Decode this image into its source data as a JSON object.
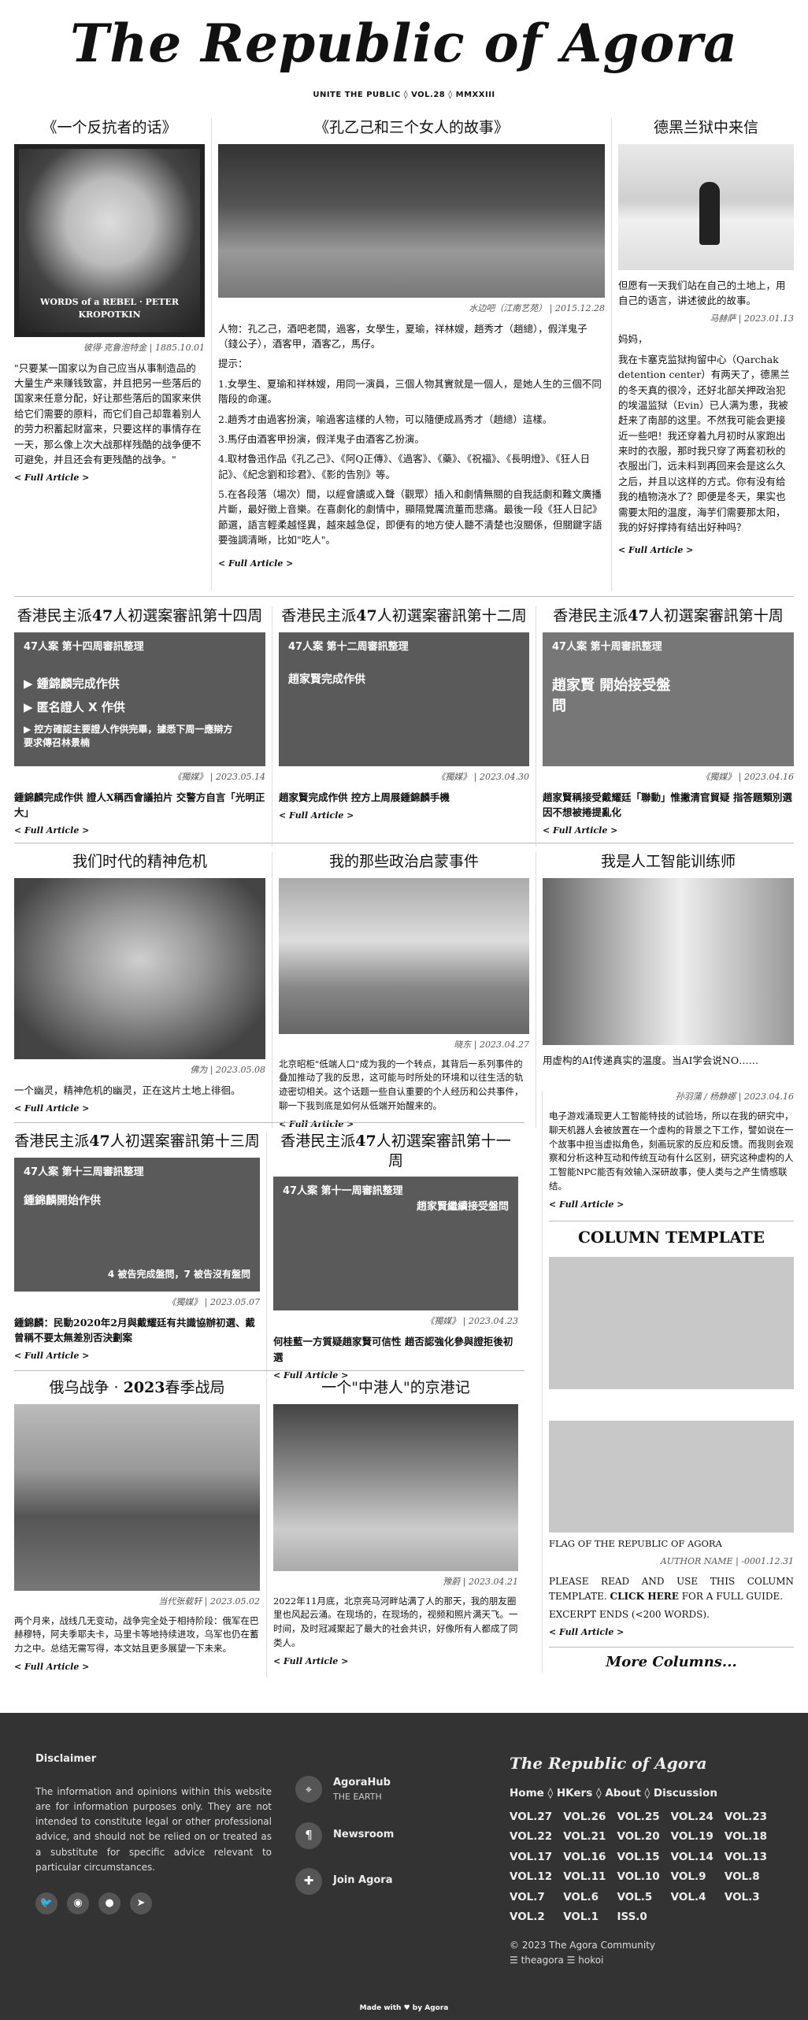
{
  "masthead": {
    "title": "The Republic of Agora",
    "subtitle": "UNITE THE PUBLIC ◊ VOL.28 ◊ MMXXIII"
  },
  "row1": {
    "a1": {
      "title": "《一个反抗者的话》",
      "img_text": "WORDS of a REBEL · PETER KROPOTKIN",
      "caption": "彼得·克鲁泡特金 | 1885.10.01",
      "body": "\"只要某一国家以为自己应当从事制造品的大量生产来赚钱致富，并且把另一些落后的国家来任意分配，好让那些落后的国家来供给它们需要的原料，而它们自己却靠着别人的劳力积蓄起财富来，只要这样的事情存在一天，那么像上次大战那样残酷的战争便不可避免，并且还会有更残酷的战争。\"",
      "more": "< Full Article >"
    },
    "a2": {
      "title": "《孔乙己和三个女人的故事》",
      "caption": "水边吧（江南艺苑） | 2015.12.28",
      "p1": "人物：孔乙己，酒吧老闆，過客，女學生，夏瑜，祥林嫂，趙秀才（趙總），假洋鬼子（錢公子），酒客甲，酒客乙，馬仔。",
      "p2": "提示：",
      "p3": "1.女學生、夏瑜和祥林嫂，用同一演員，三個人物其實就是一個人，是她人生的三個不同階段的命運。",
      "p4": "2.趙秀才由過客扮演，喻過客這樣的人物，可以隨便成爲秀才（趙總）這樣。",
      "p5": "3.馬仔由酒客甲扮演，假洋鬼子由酒客乙扮演。",
      "p6": "4.取材魯迅作品《孔乙己》、《阿Q正傳》、《過客》、《藥》、《祝福》、《長明燈》、《狂人日記》、《紀念劉和珍君》、《影的告別》等。",
      "p7": "5.在各段落（場次）間，以經會讀或入聲（觀眾）插入和劇情無關的自我話劇和難文廣播片斷，最好徵上音樂。在喜劇化的劇情中，顯隔覺厲流董而悲痛。最後一段《狂人日記》節選，語言輕柔越怪異，越來越急促，即便有的地方使人聽不清楚也沒關係，但關鍵字語要強調清晰，比如\"吃人\"。",
      "more": "< Full Article >"
    },
    "a3": {
      "title": "德黑兰狱中来信",
      "lead": "但愿有一天我们站在自己的土地上，用自己的语言，讲述彼此的故事。",
      "caption": "马赫萨 | 2023.01.13",
      "p1": "妈妈，",
      "p2": "我在卡塞克监狱拘留中心（Qarchak detention center）有两天了，德黑兰的冬天真的很冷，还好北部关押政治犯的埃温监狱（Evin）已人满为患，我被赶来了南部的这里。不然我可能会更接近一些吧！我还穿着九月初时从家跑出来时的衣服，那时我只穿了两套初秋的衣服出门，远未料到再回来会是这么久之后，并且以这样的方式。你有没有给我的植物浇水了？即便是冬天，果实也需要太阳的温度，海芋们需要那太阳，我的好好撑持有结出好种吗？",
      "more": "< Full Article >"
    }
  },
  "row2": {
    "a1": {
      "title_pre": "香港民主派",
      "title_num": "47",
      "title_post": "人初選案審訊第十四周",
      "slide_head": "47人案 第十四周審訊整理",
      "slide_b1": "▶ 鍾錦麟完成作供",
      "slide_b2": "▶ 匿名證人 X 作供",
      "slide_b3": "▶ 控方確認主要證人作供完畢，據悉下周一應辯方要求傳召林景楠",
      "caption": "《獨媒》 | 2023.05.14",
      "lead": "鍾錦麟完成作供 證人X稱西會議拍片 交警方自言「光明正大」",
      "more": "< Full Article >"
    },
    "a2": {
      "title_pre": "香港民主派",
      "title_num": "47",
      "title_post": "人初選案審訊第十二周",
      "slide_head": "47人案 第十二周審訊整理",
      "slide_sub": "趙家賢完成作供",
      "caption": "《獨媒》 | 2023.04.30",
      "lead": "趙家賢完成作供 控方上周展鍾錦麟手機",
      "more": "< Full Article >"
    },
    "a3": {
      "title_pre": "香港民主派",
      "title_num": "47",
      "title_post": "人初選案審訊第十周",
      "slide_head": "47人案 第十周審訊整理",
      "slide_sub": "趙家賢 開始接受盤問",
      "caption": "《獨媒》 | 2023.04.16",
      "lead": "趙家賢稱接受戴耀廷「聯動」惟撇清官貿疑 指答題類別選因不想被捲提亂化",
      "more": "< Full Article >"
    }
  },
  "row3": {
    "a1": {
      "title": "我们时代的精神危机",
      "caption": "佛为 | 2023.05.08",
      "lead": "一个幽灵，精神危机的幽灵，正在这片土地上徘徊。",
      "more": "< Full Article >"
    },
    "a2": {
      "title": "我的那些政治启蒙事件",
      "caption": "晓东 | 2023.04.27",
      "lead": "北京昭柜\"低端人口\"成为我的一个转点，其背后一系列事件的叠加推动了我的反思，这可能与时所处的环境和以往生活的轨迹密切相关。这个话题一些自认重要的个人经历和公共事件，聊一下我到底是如何从低端开始醒来的。",
      "more": "< Full Article >"
    },
    "a3": {
      "title": "我是人工智能训练师",
      "lead": "用虚构的AI传递真实的温度。当AI学会说NO……",
      "caption": "孙羽蒲 / 杨静娜 | 2023.04.16",
      "body": "电子游戏涌现更人工智能特技的试验场，所以在我的研究中，聊天机器人会被放置在一个虚构的背景之下工作，譬如说在一个故事中担当虚拟角色，刻画玩家的反应和反馈。而我则会观察和分析这种互动和传统互动有什么区别，研究这种虚构的人工智能NPC能否有效输入深研故事，使人类与之产生情感联结。",
      "more": "< Full Article >"
    }
  },
  "row4": {
    "a1": {
      "title_pre": "香港民主派",
      "title_num": "47",
      "title_post": "人初選案審訊第十三周",
      "slide_head": "47人案 第十三周審訊整理",
      "slide_sub": "鍾錦麟開始作供",
      "slide_foot": "4 被告完成盤問，7 被告沒有盤問",
      "caption": "《獨媒》 | 2023.05.07",
      "lead": "鍾錦麟：民動2020年2月與戴耀廷有共識協辦初選、戴曾稱不要太無差別否決劃案",
      "more": "< Full Article >"
    },
    "a2": {
      "title_pre": "香港民主派",
      "title_num": "47",
      "title_post": "人初選案審訊第十一周",
      "slide_head": "47人案 第十一周審訊整理",
      "slide_sub": "趙家賢繼續接受盤問",
      "caption": "《獨媒》 | 2023.04.23",
      "lead": "何桂藍一方質疑趙家賢可信性 趙否認強化參與證拒後初選",
      "more": "< Full Article >"
    }
  },
  "row5": {
    "a1": {
      "title_pre": "俄乌战争 · ",
      "title_num": "2023",
      "title_post": "春季战局",
      "caption": "当代张载轩 | 2023.05.02",
      "lead": "两个月来，战线几无变动，战争完全处于相持阶段：俄军在巴赫穆特，阿夫季耶夫卡，马里卡等地持续进攻，乌军也仍在蓄力之中。总结无需写得，本文姑且更多展望一下未来。",
      "more": "< Full Article >"
    },
    "a2": {
      "title": "一个\"中港人\"的京港记",
      "caption": "豫蔚 | 2023.04.21",
      "lead": "2022年11月底，北京亮马河畔站满了人的那天，我的朋友圈里也风起云涌。在现场的，在现场的，视频和照片满天飞。一时间，及时冠减聚起了最大的社会共识，好像所有人都成了同类人。",
      "more": "< Full Article >"
    }
  },
  "template": {
    "title": "COLUMN TEMPLATE",
    "flag": "FLAG OF THE REPUBLIC OF AGORA",
    "caption": "AUTHOR NAME | -0001.12.31",
    "body_pre": "PLEASE READ AND USE THIS COLUMN TEMPLATE.",
    "body_link": "CLICK HERE",
    "body_post": "FOR A FULL GUIDE.",
    "excerpt": "EXCERPT ENDS (<200 WORDS).",
    "more": "< Full Article >",
    "more_columns": "More Columns..."
  },
  "footer": {
    "disclaimer_title": "Disclaimer",
    "disclaimer": "The information and opinions within this website are for information purposes only. They are not intended to constitute legal or other professional advice, and should not be relied on or treated as a substitute for specific advice relevant to particular circumstances.",
    "links": [
      {
        "label": "AgoraHub",
        "sub": "THE EARTH"
      },
      {
        "label": "Newsroom",
        "sub": ""
      },
      {
        "label": "Join Agora",
        "sub": ""
      }
    ],
    "brand": "The Republic of Agora",
    "nav": [
      "Home",
      "HKers",
      "About",
      "Discussion"
    ],
    "vols": [
      "VOL.27",
      "VOL.26",
      "VOL.25",
      "VOL.24",
      "VOL.23",
      "VOL.22",
      "VOL.21",
      "VOL.20",
      "VOL.19",
      "VOL.18",
      "VOL.17",
      "VOL.16",
      "VOL.15",
      "VOL.14",
      "VOL.13",
      "VOL.12",
      "VOL.11",
      "VOL.10",
      "VOL.9",
      "VOL.8",
      "VOL.7",
      "VOL.6",
      "VOL.5",
      "VOL.4",
      "VOL.3",
      "VOL.2",
      "VOL.1",
      "ISS.0"
    ],
    "copyright": "© 2023 The Agora Community",
    "handles": "☰ theagora ☰ hokoi",
    "madewith": "Made with ♥ by Agora"
  }
}
